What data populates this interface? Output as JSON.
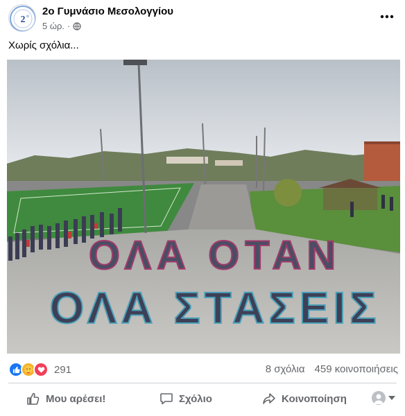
{
  "post": {
    "page_name": "2ο Γυμνάσιο Μεσολογγίου",
    "time": "5 ώρ.",
    "audience_icon": "globe-icon",
    "caption": "Χωρίς σχόλια...",
    "avatar_text": "2ο"
  },
  "photo": {
    "description_icon": "photo",
    "sign_line1": "ΟΛΑ ΟΤΑΝ",
    "sign_line2": "ΟΛΑ ΣΤΑΣΕΙΣ"
  },
  "stats": {
    "reactions": [
      "like-icon",
      "care-icon",
      "love-icon"
    ],
    "reaction_count": "291",
    "comments": "8 σχόλια",
    "shares": "459 κοινοποιήσεις"
  },
  "actions": {
    "like_label": "Μου αρέσει!",
    "comment_label": "Σχόλιο",
    "share_label": "Κοινοποίηση"
  },
  "colors": {
    "facebook_blue": "#1877f2",
    "love_red": "#f33e58",
    "care_yellow": "#f7b125",
    "secondary_text": "#65676b"
  }
}
